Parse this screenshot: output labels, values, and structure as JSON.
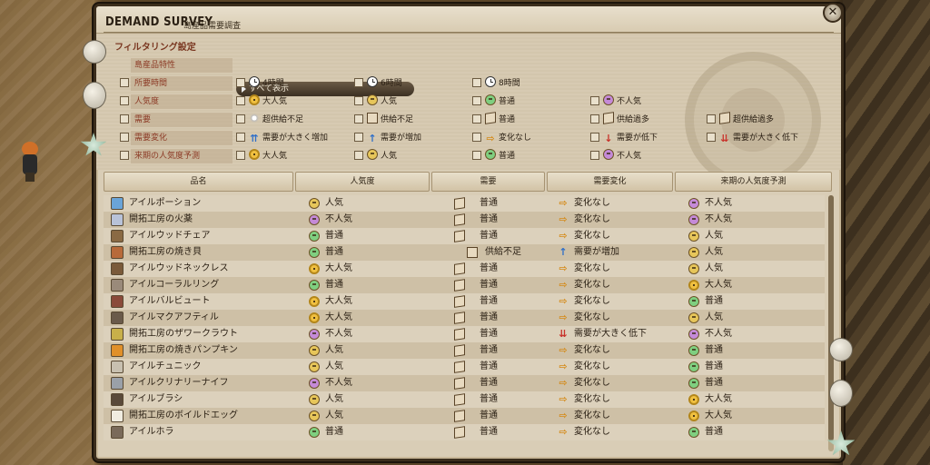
{
  "window": {
    "title": "DEMAND SURVEY",
    "subtitle": "島産品需要調査",
    "close_label": "✕"
  },
  "filter": {
    "heading": "フィルタリング設定",
    "product_trait_label": "島産品特性",
    "show_all": "すべて表示",
    "rows": [
      {
        "label": "所要時間",
        "options": [
          {
            "icon": "clock-icon",
            "text": "4時間"
          },
          {
            "icon": "clock-icon",
            "text": "6時間"
          },
          {
            "icon": "clock-icon",
            "text": "8時間"
          }
        ]
      },
      {
        "label": "人気度",
        "options": [
          {
            "icon": "very-popular-face-icon",
            "text": "大人気"
          },
          {
            "icon": "popular-face-icon",
            "text": "人気"
          },
          {
            "icon": "average-face-icon",
            "text": "普通"
          },
          {
            "icon": "unpopular-face-icon",
            "text": "不人気"
          }
        ]
      },
      {
        "label": "需要",
        "options": [
          {
            "icon": "sparkle-icon",
            "text": "超供給不足"
          },
          {
            "icon": "box-icon",
            "text": "供給不足"
          },
          {
            "icon": "boxes-icon",
            "text": "普通"
          },
          {
            "icon": "boxes-icon",
            "text": "供給過多"
          },
          {
            "icon": "boxes-icon",
            "text": "超供給過多"
          }
        ]
      },
      {
        "label": "需要変化",
        "options": [
          {
            "icon": "double-up-arrow-icon",
            "text": "需要が大きく増加"
          },
          {
            "icon": "up-arrow-icon",
            "text": "需要が増加"
          },
          {
            "icon": "right-arrow-icon",
            "text": "変化なし"
          },
          {
            "icon": "down-arrow-icon",
            "text": "需要が低下"
          },
          {
            "icon": "double-down-arrow-icon",
            "text": "需要が大きく低下"
          }
        ]
      },
      {
        "label": "来期の人気度予測",
        "options": [
          {
            "icon": "very-popular-face-icon",
            "text": "大人気"
          },
          {
            "icon": "popular-face-icon",
            "text": "人気"
          },
          {
            "icon": "average-face-icon",
            "text": "普通"
          },
          {
            "icon": "unpopular-face-icon",
            "text": "不人気"
          }
        ]
      }
    ]
  },
  "table": {
    "headers": [
      "品名",
      "人気度",
      "需要",
      "需要変化",
      "来期の人気度予測"
    ],
    "rows": [
      {
        "name": "アイルポーション",
        "item_color": "#6aa4d8",
        "popularity": "人気",
        "pop_icon": "popular",
        "demand": "普通",
        "dem_icon": "boxes",
        "change": "変化なし",
        "chg_icon": "right",
        "forecast": "不人気",
        "fc_icon": "unpopular"
      },
      {
        "name": "開拓工房の火薬",
        "item_color": "#b8c2d8",
        "popularity": "不人気",
        "pop_icon": "unpopular",
        "demand": "普通",
        "dem_icon": "boxes",
        "change": "変化なし",
        "chg_icon": "right",
        "forecast": "不人気",
        "fc_icon": "unpopular"
      },
      {
        "name": "アイルウッドチェア",
        "item_color": "#8a6a44",
        "popularity": "普通",
        "pop_icon": "average",
        "demand": "普通",
        "dem_icon": "boxes",
        "change": "変化なし",
        "chg_icon": "right",
        "forecast": "人気",
        "fc_icon": "popular"
      },
      {
        "name": "開拓工房の焼き貝",
        "item_color": "#b86a3a",
        "popularity": "普通",
        "pop_icon": "average",
        "demand": "供給不足",
        "dem_icon": "box",
        "change": "需要が増加",
        "chg_icon": "up",
        "forecast": "人気",
        "fc_icon": "popular"
      },
      {
        "name": "アイルウッドネックレス",
        "item_color": "#7a5a3a",
        "popularity": "大人気",
        "pop_icon": "verypopular",
        "demand": "普通",
        "dem_icon": "boxes",
        "change": "変化なし",
        "chg_icon": "right",
        "forecast": "人気",
        "fc_icon": "popular"
      },
      {
        "name": "アイルコーラルリング",
        "item_color": "#9a8a7a",
        "popularity": "普通",
        "pop_icon": "average",
        "demand": "普通",
        "dem_icon": "boxes",
        "change": "変化なし",
        "chg_icon": "right",
        "forecast": "大人気",
        "fc_icon": "verypopular"
      },
      {
        "name": "アイルバルビュート",
        "item_color": "#8a4a3a",
        "popularity": "大人気",
        "pop_icon": "verypopular",
        "demand": "普通",
        "dem_icon": "boxes",
        "change": "変化なし",
        "chg_icon": "right",
        "forecast": "普通",
        "fc_icon": "average"
      },
      {
        "name": "アイルマクアフティル",
        "item_color": "#6a5a4a",
        "popularity": "大人気",
        "pop_icon": "verypopular",
        "demand": "普通",
        "dem_icon": "boxes",
        "change": "変化なし",
        "chg_icon": "right",
        "forecast": "人気",
        "fc_icon": "popular"
      },
      {
        "name": "開拓工房のザワークラウト",
        "item_color": "#c8b04a",
        "popularity": "不人気",
        "pop_icon": "unpopular",
        "demand": "普通",
        "dem_icon": "boxes",
        "change": "需要が大きく低下",
        "chg_icon": "doubledown",
        "forecast": "不人気",
        "fc_icon": "unpopular"
      },
      {
        "name": "開拓工房の焼きパンプキン",
        "item_color": "#e0902a",
        "popularity": "人気",
        "pop_icon": "popular",
        "demand": "普通",
        "dem_icon": "boxes",
        "change": "変化なし",
        "chg_icon": "right",
        "forecast": "普通",
        "fc_icon": "average"
      },
      {
        "name": "アイルチュニック",
        "item_color": "#c8c0b0",
        "popularity": "人気",
        "pop_icon": "popular",
        "demand": "普通",
        "dem_icon": "boxes",
        "change": "変化なし",
        "chg_icon": "right",
        "forecast": "普通",
        "fc_icon": "average"
      },
      {
        "name": "アイルクリナリーナイフ",
        "item_color": "#9aa0a8",
        "popularity": "不人気",
        "pop_icon": "unpopular",
        "demand": "普通",
        "dem_icon": "boxes",
        "change": "変化なし",
        "chg_icon": "right",
        "forecast": "普通",
        "fc_icon": "average"
      },
      {
        "name": "アイルブラシ",
        "item_color": "#5a4a3a",
        "popularity": "人気",
        "pop_icon": "popular",
        "demand": "普通",
        "dem_icon": "boxes",
        "change": "変化なし",
        "chg_icon": "right",
        "forecast": "大人気",
        "fc_icon": "verypopular"
      },
      {
        "name": "開拓工房のボイルドエッグ",
        "item_color": "#f0ece0",
        "popularity": "人気",
        "pop_icon": "popular",
        "demand": "普通",
        "dem_icon": "boxes",
        "change": "変化なし",
        "chg_icon": "right",
        "forecast": "大人気",
        "fc_icon": "verypopular"
      },
      {
        "name": "アイルホラ",
        "item_color": "#7a6a5a",
        "popularity": "普通",
        "pop_icon": "average",
        "demand": "普通",
        "dem_icon": "boxes",
        "change": "変化なし",
        "chg_icon": "right",
        "forecast": "普通",
        "fc_icon": "average"
      }
    ]
  }
}
